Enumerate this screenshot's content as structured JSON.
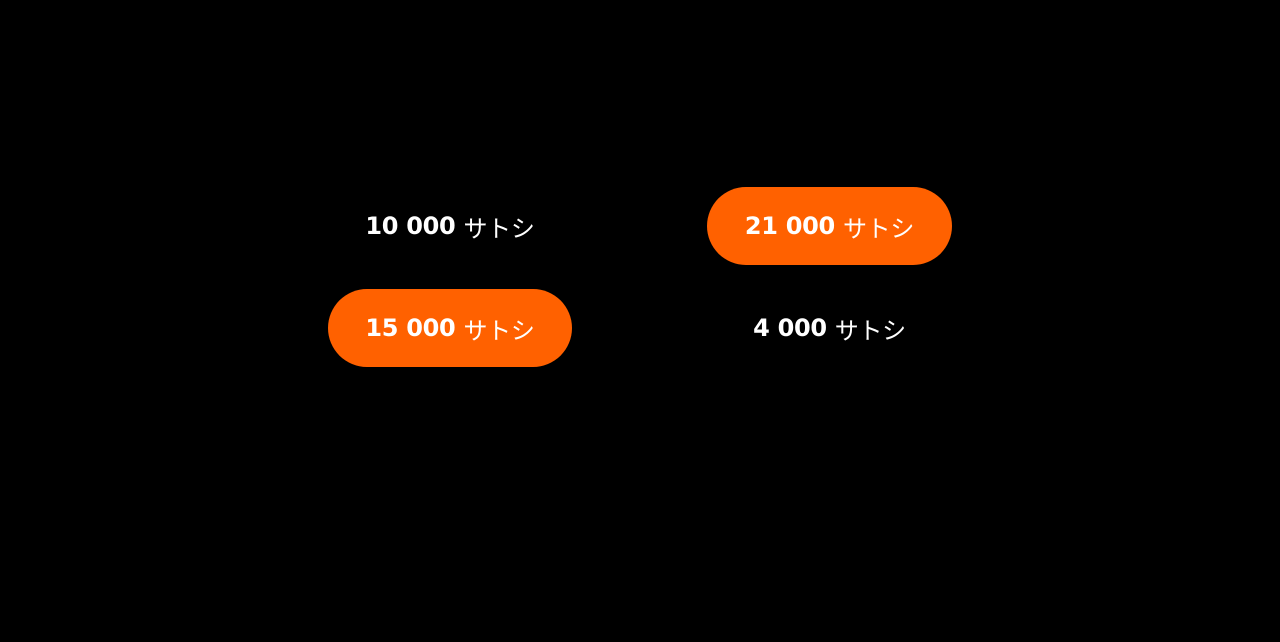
{
  "amount_options": [
    {
      "amount": "10 000",
      "unit": "サトシ",
      "selected": false
    },
    {
      "amount": "21 000",
      "unit": "サトシ",
      "selected": true
    },
    {
      "amount": "15 000",
      "unit": "サトシ",
      "selected": true
    },
    {
      "amount": "4 000",
      "unit": "サトシ",
      "selected": false
    }
  ],
  "colors": {
    "background": "#000000",
    "selected_fill": "#ff6100",
    "text": "#ffffff"
  }
}
